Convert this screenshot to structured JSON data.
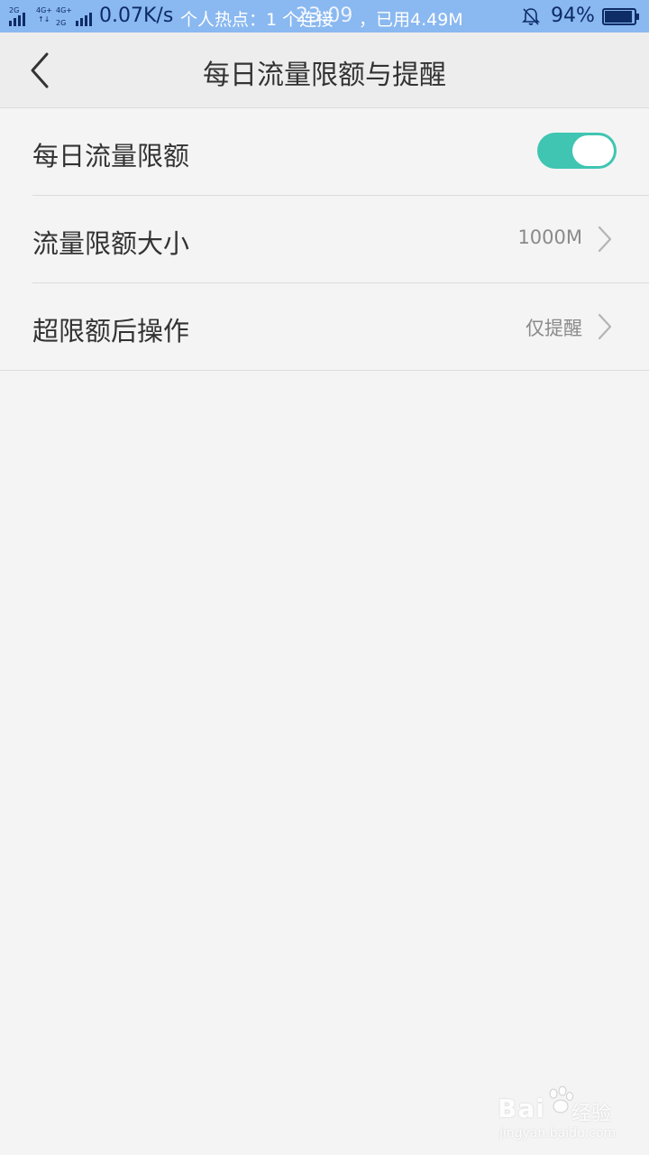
{
  "status_bar": {
    "net_label_1": "2G",
    "net_label_2": "4G+",
    "net_label_3": "4G+",
    "net_label_4": "2G",
    "speed": "0.07K/s",
    "hotspot": "个人热点：1 个连接",
    "time": "23:09",
    "used": "，已用4.49M",
    "battery": "94%",
    "battery_level": 0.94,
    "bar_color": "#8ab8f0"
  },
  "header": {
    "title": "每日流量限额与提醒",
    "back_icon": "chevron-left-icon"
  },
  "settings": {
    "daily_limit": {
      "label": "每日流量限额",
      "enabled": true,
      "toggle_color": "#3fc5b2"
    },
    "limit_size": {
      "label": "流量限额大小",
      "value": "1000M"
    },
    "over_limit_action": {
      "label": "超限额后操作",
      "value": "仅提醒"
    }
  },
  "watermark": {
    "brand": "Bai",
    "cn": "经验",
    "url": "jingyan.baidu.com"
  }
}
